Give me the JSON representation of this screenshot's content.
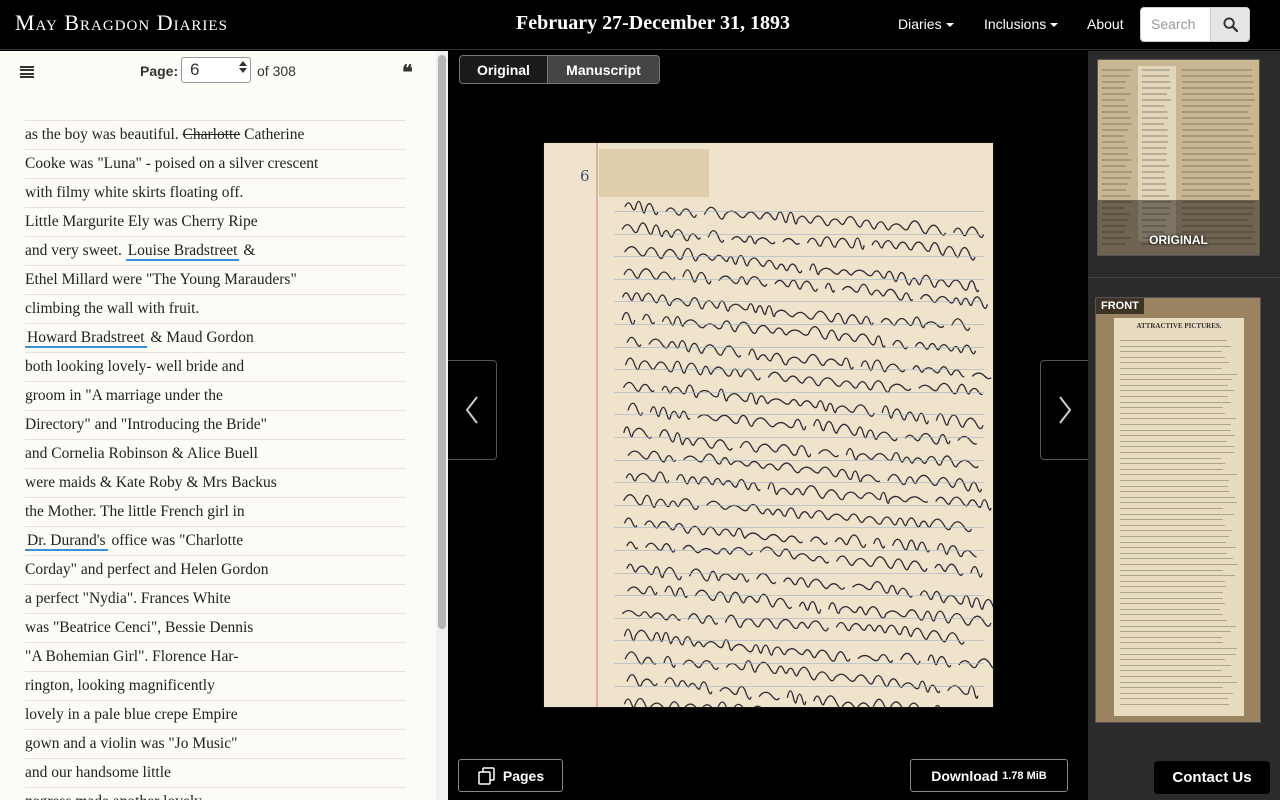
{
  "header": {
    "brand": "May Bragdon Diaries",
    "date_range": "February 27-December 31, 1893",
    "nav": [
      {
        "label": "Diaries",
        "dropdown": true
      },
      {
        "label": "Inclusions",
        "dropdown": true
      },
      {
        "label": "About",
        "dropdown": false
      }
    ],
    "search_placeholder": "Search"
  },
  "transcript_panel": {
    "page_label": "Page:",
    "page_value": "6",
    "page_total": "of 308",
    "lines": [
      {
        "segments": [
          {
            "t": "as the boy was beautiful. "
          },
          {
            "t": "Charlotte",
            "s": "struck"
          },
          {
            "t": " Catherine"
          }
        ]
      },
      {
        "segments": [
          {
            "t": "Cooke was \"Luna\" - poised on a silver crescent"
          }
        ]
      },
      {
        "segments": [
          {
            "t": "with filmy white skirts floating off."
          }
        ]
      },
      {
        "segments": [
          {
            "t": "Little Margurite Ely was Cherry Ripe"
          }
        ]
      },
      {
        "segments": [
          {
            "t": "and very sweet. "
          },
          {
            "t": "Louise Bradstreet",
            "s": "person"
          },
          {
            "t": " &"
          }
        ]
      },
      {
        "segments": [
          {
            "t": "Ethel Millard were \"The Young Marauders\""
          }
        ]
      },
      {
        "segments": [
          {
            "t": "climbing the wall with fruit."
          }
        ]
      },
      {
        "segments": [
          {
            "t": "Howard Bradstreet",
            "s": "person"
          },
          {
            "t": " & Maud Gordon"
          }
        ]
      },
      {
        "segments": [
          {
            "t": "both looking lovely- well bride and"
          }
        ]
      },
      {
        "segments": [
          {
            "t": "groom in \"A marriage under the"
          }
        ]
      },
      {
        "segments": [
          {
            "t": "Directory\" and \"Introducing the Bride\""
          }
        ]
      },
      {
        "segments": [
          {
            "t": "and Cornelia Robinson & Alice Buell"
          }
        ]
      },
      {
        "segments": [
          {
            "t": "were maids & Kate Roby & Mrs Backus"
          }
        ]
      },
      {
        "segments": [
          {
            "t": "the Mother. The little French girl in"
          }
        ]
      },
      {
        "segments": [
          {
            "t": "Dr. Durand's",
            "s": "person"
          },
          {
            "t": " office was \"Charlotte"
          }
        ]
      },
      {
        "segments": [
          {
            "t": "Corday\" and perfect and Helen Gordon"
          }
        ]
      },
      {
        "segments": [
          {
            "t": "a perfect \"Nydia\". Frances White"
          }
        ]
      },
      {
        "segments": [
          {
            "t": "was \"Beatrice Cenci\", Bessie Dennis"
          }
        ]
      },
      {
        "segments": [
          {
            "t": "\"A Bohemian Girl\". Florence Har-"
          }
        ]
      },
      {
        "segments": [
          {
            "t": "rington, looking magnificently"
          }
        ]
      },
      {
        "segments": [
          {
            "t": "lovely in a pale blue crepe Empire"
          }
        ]
      },
      {
        "segments": [
          {
            "t": "gown and a violin was \"Jo Music\""
          }
        ]
      },
      {
        "segments": [
          {
            "t": "and our handsome little"
          }
        ]
      },
      {
        "segments": [
          {
            "t": "negress made another lovely"
          }
        ]
      }
    ]
  },
  "viewer": {
    "toggle": [
      "Original",
      "Manuscript"
    ],
    "active_toggle": "Manuscript",
    "manuscript_page_number": "6",
    "pages_button": "Pages",
    "download_label": "Download",
    "download_size": "1.78 MiB"
  },
  "thumbnails": {
    "original_label": "ORIGINAL",
    "front_label": "FRONT",
    "clipping_headline": "ATTRACTIVE PICTURES."
  },
  "contact_label": "Contact Us",
  "colors": {
    "panel_bg": "#fdfbf5",
    "person_underline": "#3a8fd6",
    "viewer_bg": "#000000"
  }
}
